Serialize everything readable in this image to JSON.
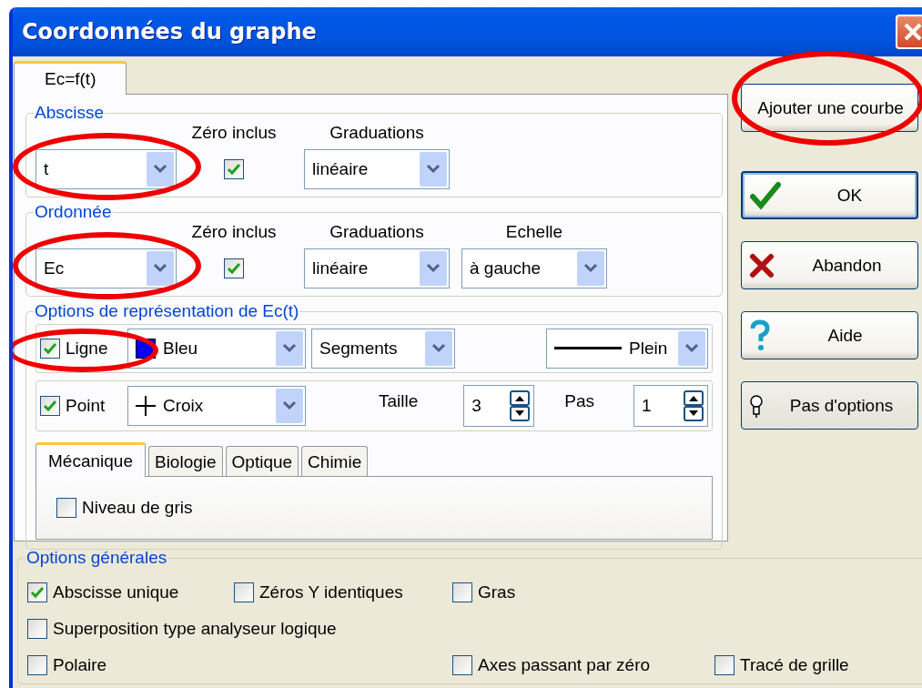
{
  "window": {
    "title": "Coordonnées du graphe"
  },
  "tabs": [
    {
      "label": "Ec=f(t)",
      "selected": true
    }
  ],
  "abscissa": {
    "legend": "Abscisse",
    "variable": "t",
    "highlighted": true,
    "zero_label": "Zéro inclus",
    "zero_included": true,
    "scale_label": "Graduations",
    "scale": "linéaire"
  },
  "ordinate": {
    "legend": "Ordonnée",
    "variable": "Ec",
    "highlighted": true,
    "zero_label": "Zéro inclus",
    "zero_included": true,
    "scale_label": "Graduations",
    "scale": "linéaire",
    "side_label": "Echelle",
    "side": "à gauche"
  },
  "representation": {
    "legend": "Options de représentation de Ec(t)",
    "line": {
      "label": "Ligne",
      "checked": true,
      "highlighted": true,
      "color_name": "Bleu",
      "color": "#0000ff",
      "style": "Segments",
      "pattern": "Plein"
    },
    "point": {
      "label": "Point",
      "checked": true,
      "marker": "Croix",
      "size_label": "Taille",
      "size": "3",
      "step_label": "Pas",
      "step": "1"
    },
    "subtabs": [
      {
        "label": "Mécanique",
        "selected": true
      },
      {
        "label": "Biologie",
        "selected": false
      },
      {
        "label": "Optique",
        "selected": false
      },
      {
        "label": "Chimie",
        "selected": false
      }
    ],
    "grey_level": {
      "label": "Niveau de gris",
      "checked": false
    }
  },
  "buttons": [
    {
      "label": "Ajouter une courbe",
      "kind": "add",
      "default": false,
      "highlighted": true
    },
    {
      "label": "OK",
      "kind": "ok",
      "default": true,
      "highlighted": false
    },
    {
      "label": "Abandon",
      "kind": "cancel",
      "default": false,
      "highlighted": false
    },
    {
      "label": "Aide",
      "kind": "help",
      "default": false,
      "highlighted": false
    },
    {
      "label": "Pas d'options",
      "kind": "options",
      "default": false,
      "highlighted": false
    }
  ],
  "general": {
    "legend": "Options générales",
    "options": [
      {
        "label": "Abscisse unique",
        "checked": true
      },
      {
        "label": "Zéros Y identiques",
        "checked": false
      },
      {
        "label": "Gras",
        "checked": false
      },
      {
        "label": "Superposition type analyseur logique",
        "checked": false
      },
      {
        "label": "Polaire",
        "checked": false
      },
      {
        "label": "Axes passant par zéro",
        "checked": false
      },
      {
        "label": "Tracé de grille",
        "checked": false
      }
    ]
  }
}
